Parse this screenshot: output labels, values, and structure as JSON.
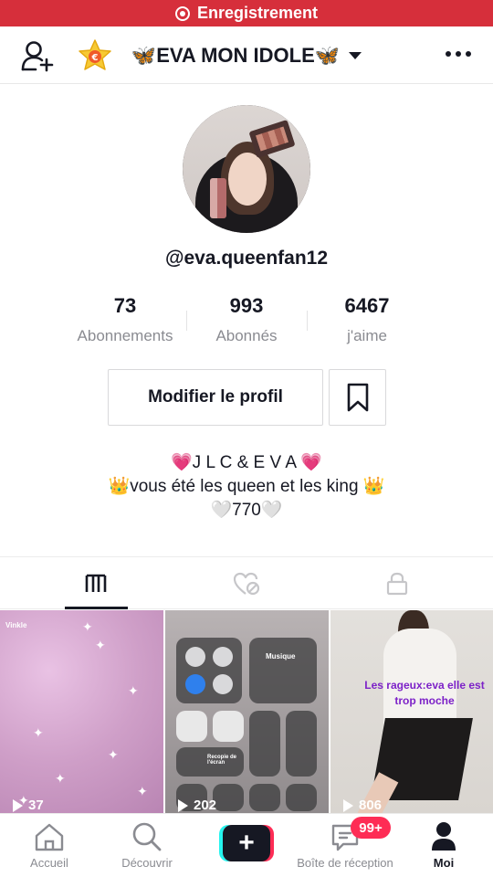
{
  "recording": {
    "label": "Enregistrement"
  },
  "header": {
    "title": "🦋EVA MON IDOLE🦋"
  },
  "profile": {
    "username": "@eva.queenfan12"
  },
  "stats": [
    {
      "value": "73",
      "label": "Abonnements"
    },
    {
      "value": "993",
      "label": "Abonnés"
    },
    {
      "value": "6467",
      "label": "j'aime"
    }
  ],
  "actions": {
    "edit_profile": "Modifier le profil"
  },
  "bio": {
    "line1": "💗J L C & E V A 💗",
    "line2": "👑vous été les queen et les king 👑",
    "line3": "🤍770🤍"
  },
  "videos": [
    {
      "views": "37",
      "watermark": "Vinkle"
    },
    {
      "views": "202",
      "music_label": "Musique",
      "mirror_label": "Recopie de l'écran"
    },
    {
      "views": "806",
      "caption": "Les rageux:eva elle est trop moche"
    }
  ],
  "bottom_nav": {
    "home": "Accueil",
    "discover": "Découvrir",
    "inbox": "Boîte de réception",
    "inbox_badge": "99+",
    "me": "Moi"
  },
  "colors": {
    "recording_bar": "#d62f3b",
    "badge": "#fe2c55",
    "accent_cyan": "#25f4ee",
    "caption_purple": "#7d22c8"
  }
}
